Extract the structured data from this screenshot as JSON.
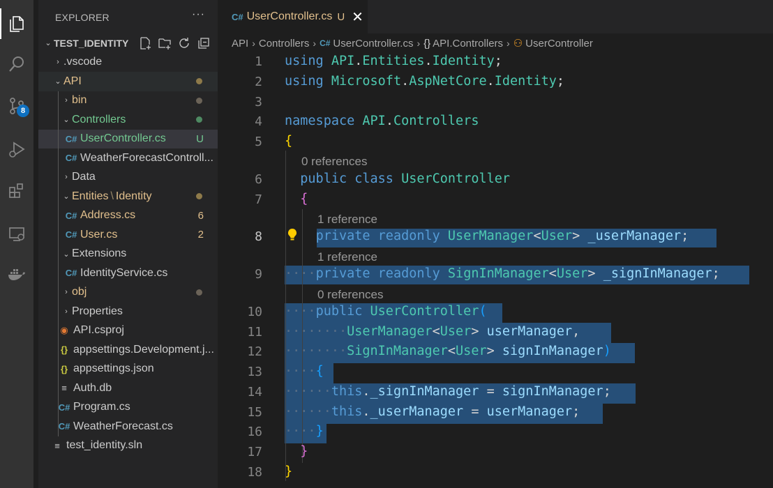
{
  "activity_bar": {
    "items": [
      "explorer-icon",
      "search-icon",
      "source-control-icon",
      "run-debug-icon",
      "extensions-icon",
      "remote-explorer-icon",
      "docker-icon"
    ],
    "source_control_badge": "8"
  },
  "sidebar": {
    "title": "EXPLORER",
    "more": "···",
    "root": "TEST_IDENTITY",
    "tree": [
      {
        "label": ".vscode",
        "kind": "folder",
        "expanded": false
      },
      {
        "label": "API",
        "kind": "folder",
        "expanded": true
      },
      {
        "label": "bin",
        "kind": "folder",
        "expanded": false
      },
      {
        "label": "Controllers",
        "kind": "folder",
        "expanded": true
      },
      {
        "label": "UserController.cs",
        "kind": "file",
        "decoration": "U"
      },
      {
        "label": "WeatherForecastControll...",
        "kind": "file"
      },
      {
        "label": "Data",
        "kind": "folder",
        "expanded": false
      },
      {
        "label": "Entities",
        "sep": "\\",
        "label2": "Identity",
        "kind": "folder",
        "expanded": true
      },
      {
        "label": "Address.cs",
        "kind": "file",
        "decoration": "6"
      },
      {
        "label": "User.cs",
        "kind": "file",
        "decoration": "2"
      },
      {
        "label": "Extensions",
        "kind": "folder",
        "expanded": true
      },
      {
        "label": "IdentityService.cs",
        "kind": "file"
      },
      {
        "label": "obj",
        "kind": "folder",
        "expanded": false
      },
      {
        "label": "Properties",
        "kind": "folder",
        "expanded": false
      },
      {
        "label": "API.csproj",
        "kind": "file"
      },
      {
        "label": "appsettings.Development.j...",
        "kind": "file"
      },
      {
        "label": "appsettings.json",
        "kind": "file"
      },
      {
        "label": "Auth.db",
        "kind": "file"
      },
      {
        "label": "Program.cs",
        "kind": "file"
      },
      {
        "label": "WeatherForecast.cs",
        "kind": "file"
      },
      {
        "label": "test_identity.sln",
        "kind": "file"
      }
    ],
    "glyphs": {
      "cs": "C#",
      "json": "{}",
      "rss": ")"
    }
  },
  "tab": {
    "name": "UserController.cs",
    "status": "U",
    "close": "✕",
    "cs": "C#"
  },
  "breadcrumb": {
    "items": [
      "API",
      "Controllers",
      "UserController.cs",
      "API.Controllers",
      "UserController"
    ],
    "ns_glyph": "{}"
  },
  "editor": {
    "line_numbers": [
      "1",
      "2",
      "3",
      "4",
      "5",
      "6",
      "7",
      "8",
      "9",
      "10",
      "11",
      "12",
      "13",
      "14",
      "15",
      "16",
      "17",
      "18"
    ],
    "code_lens": [
      "0 references",
      "1 reference",
      "1 reference",
      "0 references"
    ],
    "lines": {
      "l1": "using API.Entities.Identity;",
      "l2": "using Microsoft.AspNetCore.Identity;",
      "l4": "namespace API.Controllers",
      "l6": "public class UserController",
      "l8": "private readonly UserManager<User> _userManager;",
      "l9": "private readonly SignInManager<User> _signInManager;",
      "l10": "public UserController(",
      "l11": "UserManager<User> userManager,",
      "l12": "SignInManager<User> signInManager)",
      "l14": "this._signInManager = signInManager;",
      "l15": "this._userManager = userManager;"
    }
  },
  "colors": {
    "keyword": "#569cd6",
    "type": "#4ec9b0",
    "identifier": "#9cdcfe",
    "selection": "#264f78",
    "modified": "#e2c08d",
    "folder_mod": "#e2c08d"
  }
}
